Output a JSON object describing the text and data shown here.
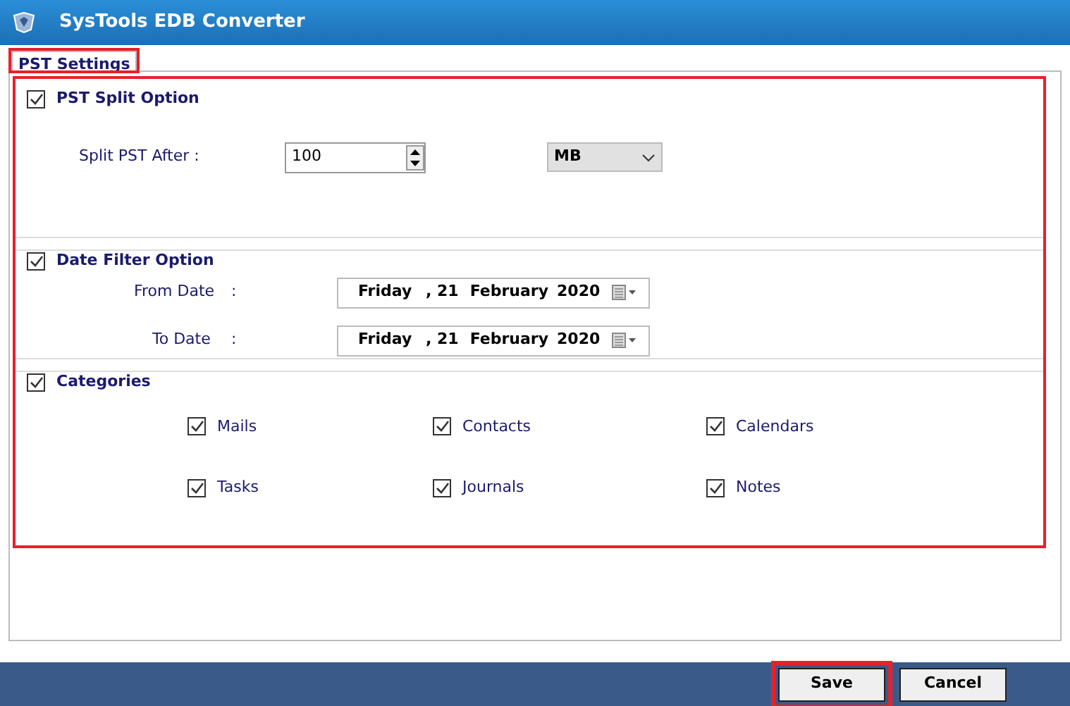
{
  "window": {
    "title": "SysTools  EDB Converter"
  },
  "tabs": [
    {
      "label": "PST Settings",
      "selected": true,
      "highlighted": true
    }
  ],
  "settings_panel": {
    "highlighted": true
  },
  "split": {
    "label": "PST Split Option",
    "checked": true,
    "field_label": "Split PST After :",
    "value": "100",
    "unit": "MB"
  },
  "date_filter": {
    "label": "Date Filter Option",
    "checked": true,
    "dates": [
      {
        "label": "From Date",
        "colon": ":",
        "weekday": "Friday",
        "day": ", 21",
        "month": "February",
        "year": "2020"
      },
      {
        "label": "To Date",
        "colon": ":",
        "weekday": "Friday",
        "day": ", 21",
        "month": "February",
        "year": "2020"
      }
    ]
  },
  "categories": {
    "label": "Categories",
    "checked": true,
    "items": [
      {
        "label": "Mails",
        "checked": true
      },
      {
        "label": "Contacts",
        "checked": true
      },
      {
        "label": "Calendars",
        "checked": true
      },
      {
        "label": "Tasks",
        "checked": true
      },
      {
        "label": "Journals",
        "checked": true
      },
      {
        "label": "Notes",
        "checked": true
      }
    ]
  },
  "buttons": [
    {
      "label": "Save",
      "highlighted": true
    },
    {
      "label": "Cancel",
      "highlighted": false
    }
  ]
}
